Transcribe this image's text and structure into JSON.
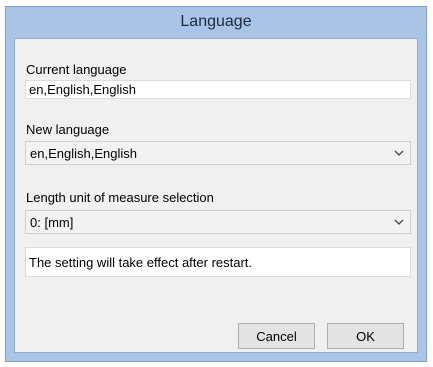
{
  "window": {
    "title": "Language"
  },
  "current_language": {
    "label": "Current language",
    "value": "en,English,English"
  },
  "new_language": {
    "label": "New language",
    "selected": "en,English,English"
  },
  "length_unit": {
    "label": "Length unit of measure selection",
    "selected": "0: [mm]"
  },
  "notice": "The setting will take effect after restart.",
  "buttons": {
    "cancel": "Cancel",
    "ok": "OK"
  },
  "icons": {
    "dropdown": "chevron-down-icon"
  },
  "colors": {
    "titlebar": "#a9c4e6",
    "client": "#f0f0f0",
    "title_text": "#1b2a3f"
  }
}
